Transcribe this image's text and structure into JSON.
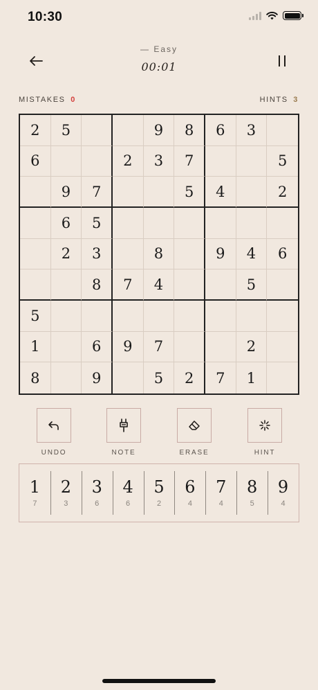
{
  "status_bar": {
    "time": "10:30"
  },
  "header": {
    "difficulty": "—  Easy",
    "timer": "00:01"
  },
  "stats": {
    "mistakes_label": "MISTAKES",
    "mistakes_count": "0",
    "hints_label": "HINTS",
    "hints_count": "3"
  },
  "board": {
    "rows": [
      [
        "2",
        "5",
        "",
        "",
        "9",
        "8",
        "6",
        "3",
        ""
      ],
      [
        "6",
        "",
        "",
        "2",
        "3",
        "7",
        "",
        "",
        "5"
      ],
      [
        "",
        "9",
        "7",
        "",
        "",
        "5",
        "4",
        "",
        "2"
      ],
      [
        "",
        "6",
        "5",
        "",
        "",
        "",
        "",
        "",
        ""
      ],
      [
        "",
        "2",
        "3",
        "",
        "8",
        "",
        "9",
        "4",
        "6"
      ],
      [
        "",
        "",
        "8",
        "7",
        "4",
        "",
        "",
        "5",
        ""
      ],
      [
        "5",
        "",
        "",
        "",
        "",
        "",
        "",
        "",
        ""
      ],
      [
        "1",
        "",
        "6",
        "9",
        "7",
        "",
        "",
        "2",
        ""
      ],
      [
        "8",
        "",
        "9",
        "",
        "5",
        "2",
        "7",
        "1",
        ""
      ]
    ]
  },
  "tools": {
    "undo": "UNDO",
    "note": "NOTE",
    "erase": "ERASE",
    "hint": "HINT"
  },
  "numpad": [
    {
      "digit": "1",
      "remaining": "7"
    },
    {
      "digit": "2",
      "remaining": "3"
    },
    {
      "digit": "3",
      "remaining": "6"
    },
    {
      "digit": "4",
      "remaining": "6"
    },
    {
      "digit": "5",
      "remaining": "2"
    },
    {
      "digit": "6",
      "remaining": "4"
    },
    {
      "digit": "7",
      "remaining": "4"
    },
    {
      "digit": "8",
      "remaining": "5"
    },
    {
      "digit": "9",
      "remaining": "4"
    }
  ],
  "colors": {
    "background": "#f1e8df",
    "mistakes_accent": "#d4413e",
    "hints_accent": "#9a7b4f",
    "tool_border": "#c8aaa4"
  }
}
